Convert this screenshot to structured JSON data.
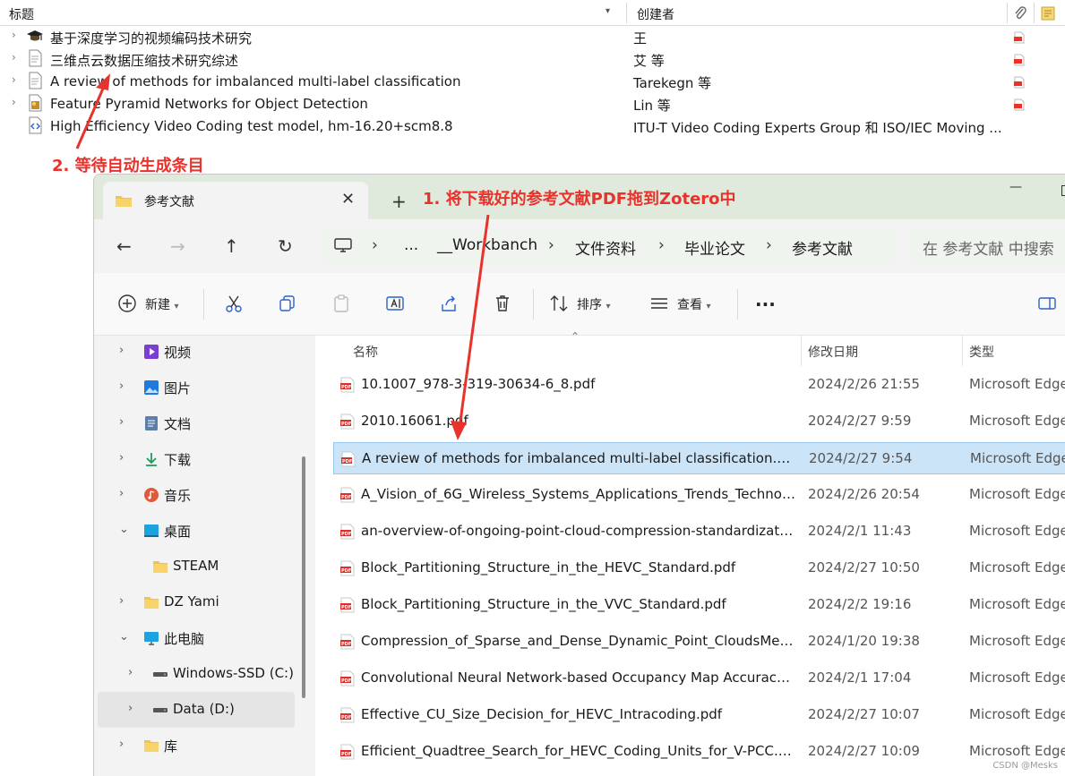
{
  "zotero": {
    "header": {
      "title": "标题",
      "creator": "创建者"
    },
    "items": [
      {
        "title": "基于深度学习的视频编码技术研究",
        "creator": "王",
        "type": "thesis",
        "has_pdf": true,
        "expandable": true
      },
      {
        "title": "三维点云数据压缩技术研究综述",
        "creator": "艾 等",
        "type": "document",
        "has_pdf": true,
        "expandable": true
      },
      {
        "title": "A review of methods for imbalanced multi-label classification",
        "creator": "Tarekegn 等",
        "type": "document",
        "has_pdf": true,
        "expandable": true
      },
      {
        "title": "Feature Pyramid Networks for Object Detection",
        "creator": "Lin 等",
        "type": "conference-paper",
        "has_pdf": true,
        "expandable": true
      },
      {
        "title": "High Efficiency Video Coding test model, hm-16.20+scm8.8",
        "creator": "ITU-T Video Coding Experts Group 和 ISO/IEC Moving ...",
        "type": "software",
        "has_pdf": false,
        "expandable": false
      }
    ]
  },
  "annotations": {
    "step2": "2. 等待自动生成条目",
    "step1": "1. 将下载好的参考文献PDF拖到Zotero中",
    "accent": "#e8322c"
  },
  "explorer": {
    "tab_label": "参考文献",
    "breadcrumb": [
      "...",
      "__Workbanch",
      "文件资料",
      "毕业论文",
      "参考文献"
    ],
    "search_placeholder": "在 参考文献 中搜索",
    "toolbar": {
      "new": "新建",
      "sort": "排序",
      "view": "查看",
      "more": "..."
    },
    "nav": [
      {
        "label": "视频",
        "icon": "videos-icon",
        "expanded": false
      },
      {
        "label": "图片",
        "icon": "pictures-icon",
        "expanded": false
      },
      {
        "label": "文档",
        "icon": "documents-icon",
        "expanded": false
      },
      {
        "label": "下载",
        "icon": "downloads-icon",
        "expanded": false
      },
      {
        "label": "音乐",
        "icon": "music-icon",
        "expanded": false
      },
      {
        "label": "桌面",
        "icon": "desktop-icon",
        "expanded": true
      },
      {
        "label": "STEAM",
        "icon": "folder-icon",
        "expanded": null
      },
      {
        "label": "DZ Yami",
        "icon": "folder-icon",
        "expanded": false
      },
      {
        "label": "此电脑",
        "icon": "this-pc-icon",
        "expanded": true
      },
      {
        "label": "Windows-SSD (C:)",
        "icon": "drive-icon",
        "expanded": false
      },
      {
        "label": "Data (D:)",
        "icon": "drive-icon",
        "expanded": false,
        "selected": true
      },
      {
        "label": "库",
        "icon": "library-icon",
        "expanded": false
      }
    ],
    "columns": {
      "name": "名称",
      "modified": "修改日期",
      "type": "类型"
    },
    "files": [
      {
        "name": "10.1007_978-3-319-30634-6_8.pdf",
        "modified": "2024/2/26 21:55",
        "type": "Microsoft Edge"
      },
      {
        "name": "2010.16061.pdf",
        "modified": "2024/2/27 9:59",
        "type": "Microsoft Edge"
      },
      {
        "name": "A review of methods for imbalanced multi-label classification.pdf",
        "modified": "2024/2/27 9:54",
        "type": "Microsoft Edge",
        "selected": true
      },
      {
        "name": "A_Vision_of_6G_Wireless_Systems_Applications_Trends_Technol...",
        "modified": "2024/2/26 20:54",
        "type": "Microsoft Edge"
      },
      {
        "name": "an-overview-of-ongoing-point-cloud-compression-standardizati...",
        "modified": "2024/2/1 11:43",
        "type": "Microsoft Edge"
      },
      {
        "name": "Block_Partitioning_Structure_in_the_HEVC_Standard.pdf",
        "modified": "2024/2/27 10:50",
        "type": "Microsoft Edge"
      },
      {
        "name": "Block_Partitioning_Structure_in_the_VVC_Standard.pdf",
        "modified": "2024/2/2 19:16",
        "type": "Microsoft Edge"
      },
      {
        "name": "Compression_of_Sparse_and_Dense_Dynamic_Point_CloudsMeth...",
        "modified": "2024/1/20 19:38",
        "type": "Microsoft Edge"
      },
      {
        "name": "Convolutional Neural Network-based Occupancy Map Accuracy I...",
        "modified": "2024/2/1 17:04",
        "type": "Microsoft Edge"
      },
      {
        "name": "Effective_CU_Size_Decision_for_HEVC_Intracoding.pdf",
        "modified": "2024/2/27 10:07",
        "type": "Microsoft Edge"
      },
      {
        "name": "Efficient_Quadtree_Search_for_HEVC_Coding_Units_for_V-PCC.pdf",
        "modified": "2024/2/27 10:09",
        "type": "Microsoft Edge"
      }
    ]
  },
  "watermark": "CSDN @Mesks"
}
